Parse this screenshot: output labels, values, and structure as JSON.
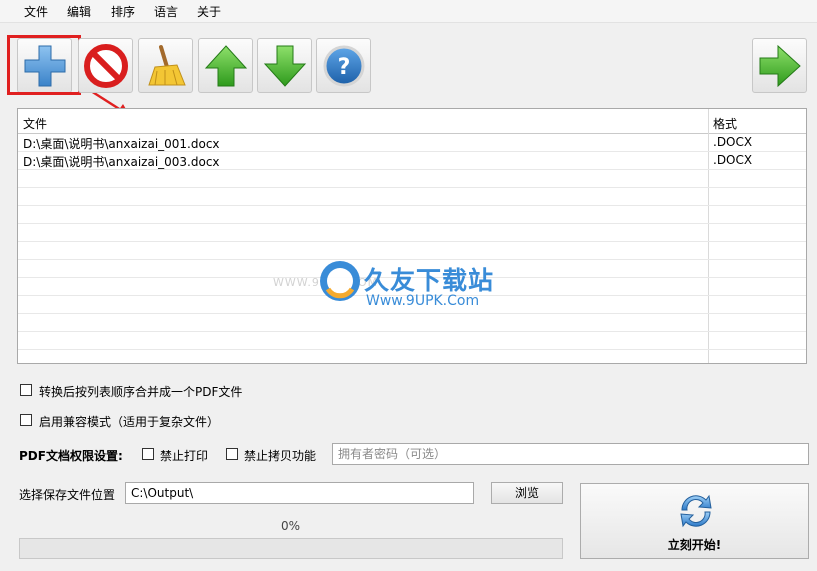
{
  "menu": [
    "文件",
    "编辑",
    "排序",
    "语言",
    "关于"
  ],
  "toolbar": {
    "add": "add-files",
    "remove": "remove-file",
    "clear": "clear-list",
    "up": "move-up",
    "down": "move-down",
    "help": "help",
    "next": "next"
  },
  "filelist": {
    "col_file": "文件",
    "col_format": "格式",
    "rows": [
      {
        "file": "D:\\桌面\\说明书\\anxaizai_001.docx",
        "format": ".DOCX"
      },
      {
        "file": "D:\\桌面\\说明书\\anxaizai_003.docx",
        "format": ".DOCX"
      }
    ]
  },
  "watermark": {
    "site": "WWW.9UPK.COM",
    "title": "久友下载站",
    "url": "Www.9UPK.Com"
  },
  "options": {
    "merge": "转换后按列表顺序合并成一个PDF文件",
    "compat": "启用兼容模式（适用于复杂文件）",
    "perm_label": "PDF文档权限设置:",
    "no_print": "禁止打印",
    "no_copy": "禁止拷贝功能",
    "password_placeholder": "拥有者密码（可选）"
  },
  "output": {
    "label": "选择保存文件位置",
    "path": "C:\\Output\\",
    "browse": "浏览"
  },
  "progress": {
    "text": "0%",
    "value": 0
  },
  "start": {
    "label": "立刻开始!"
  },
  "colors": {
    "accent": "#2f86d6",
    "highlight": "#e02020",
    "green": "#3fae2a"
  }
}
